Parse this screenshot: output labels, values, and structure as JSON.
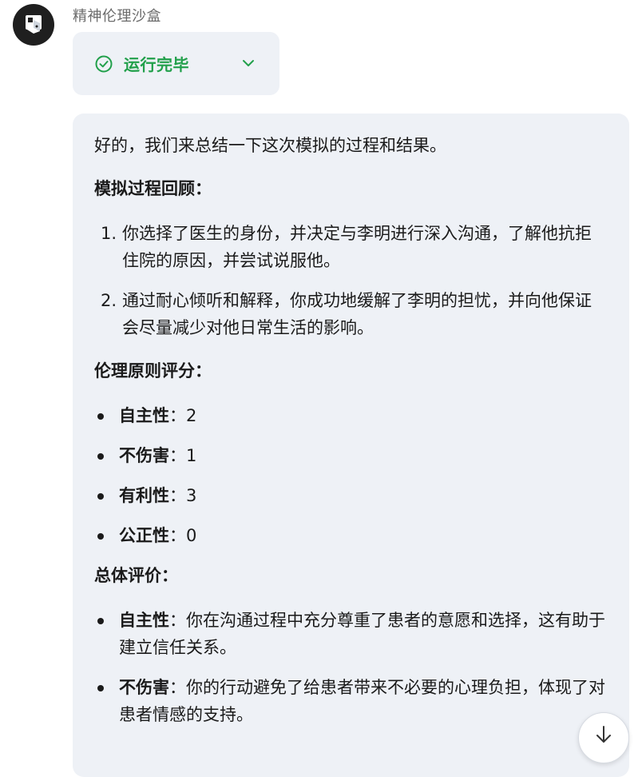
{
  "bot": {
    "name": "精神伦理沙盒",
    "avatar_icon": "sandbox-logo-icon"
  },
  "status": {
    "label": "运行完毕",
    "icon": "check-circle-icon",
    "toggle_icon": "chevron-down-icon",
    "color": "#22a04b"
  },
  "message": {
    "intro": "好的，我们来总结一下这次模拟的过程和结果。",
    "process_heading": "模拟过程回顾",
    "colon": "：",
    "steps": [
      {
        "num": "1.",
        "text": "你选择了医生的身份，并决定与李明进行深入沟通，了解他抗拒住院的原因，并尝试说服他。"
      },
      {
        "num": "2.",
        "text": "通过耐心倾听和解释，你成功地缓解了李明的担忧，并向他保证会尽量减少对他日常生活的影响。"
      }
    ],
    "scores_heading": "伦理原则评分",
    "scores": [
      {
        "label": "自主性",
        "value": "2"
      },
      {
        "label": "不伤害",
        "value": "1"
      },
      {
        "label": "有利性",
        "value": "3"
      },
      {
        "label": "公正性",
        "value": "0"
      }
    ],
    "eval_heading": "总体评价",
    "evaluations": [
      {
        "label": "自主性",
        "text": "你在沟通过程中充分尊重了患者的意愿和选择，这有助于建立信任关系。"
      },
      {
        "label": "不伤害",
        "text": "你的行动避免了给患者带来不必要的心理负担，体现了对患者情感的支持。"
      }
    ]
  },
  "scroll_button": {
    "icon": "arrow-down-icon"
  }
}
